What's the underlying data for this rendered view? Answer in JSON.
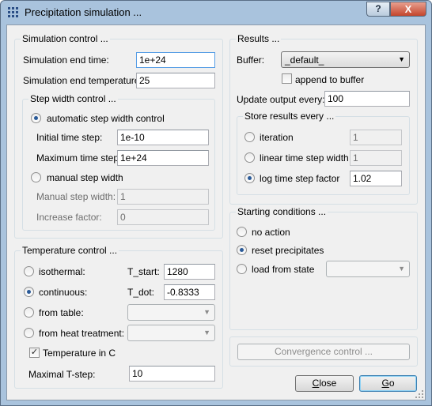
{
  "window": {
    "title": "Precipitation simulation ...",
    "help_glyph": "?",
    "close_glyph": "X"
  },
  "simulation_control": {
    "title": "Simulation control ...",
    "end_time_label": "Simulation end time:",
    "end_time_value": "1e+24",
    "end_temp_label": "Simulation end temperature:",
    "end_temp_value": "25",
    "step_width": {
      "title": "Step width control ...",
      "automatic_label": "automatic step width  control",
      "initial_step_label": "Initial time step:",
      "initial_step_value": "1e-10",
      "max_step_label": "Maximum time step:",
      "max_step_value": "1e+24",
      "manual_label": "manual step width",
      "manual_step_label": "Manual step width:",
      "manual_step_value": "1",
      "increase_label": "Increase factor:",
      "increase_value": "0"
    }
  },
  "temperature_control": {
    "title": "Temperature control ...",
    "isothermal_label": "isothermal:",
    "t_start_label": "T_start:",
    "t_start_value": "1280",
    "continuous_label": "continuous:",
    "t_dot_label": "T_dot:",
    "t_dot_value": "-0.8333",
    "from_table_label": "from table:",
    "from_table_value": "",
    "from_heat_label": "from heat treatment:",
    "from_heat_value": "",
    "temp_in_c_label": "Temperature in C",
    "temp_in_c_checked": true,
    "max_tstep_label": "Maximal T-step:",
    "max_tstep_value": "10"
  },
  "results": {
    "title": "Results ...",
    "buffer_label": "Buffer:",
    "buffer_value": "_default_",
    "append_label": "append to buffer",
    "update_label": "Update output every:",
    "update_value": "100",
    "store": {
      "title": "Store results every ...",
      "iteration_label": "iteration",
      "iteration_value": "1",
      "linear_label": "linear time step width",
      "linear_value": "1",
      "log_label": "log time step factor",
      "log_value": "1.02"
    }
  },
  "starting_conditions": {
    "title": "Starting conditions ...",
    "no_action_label": "no action",
    "reset_label": "reset precipitates",
    "load_label": "load from state",
    "load_value": ""
  },
  "convergence_label": "Convergence control ...",
  "buttons": {
    "close_c": "C",
    "close_rest": "lose",
    "go_g": "G",
    "go_rest": "o"
  }
}
